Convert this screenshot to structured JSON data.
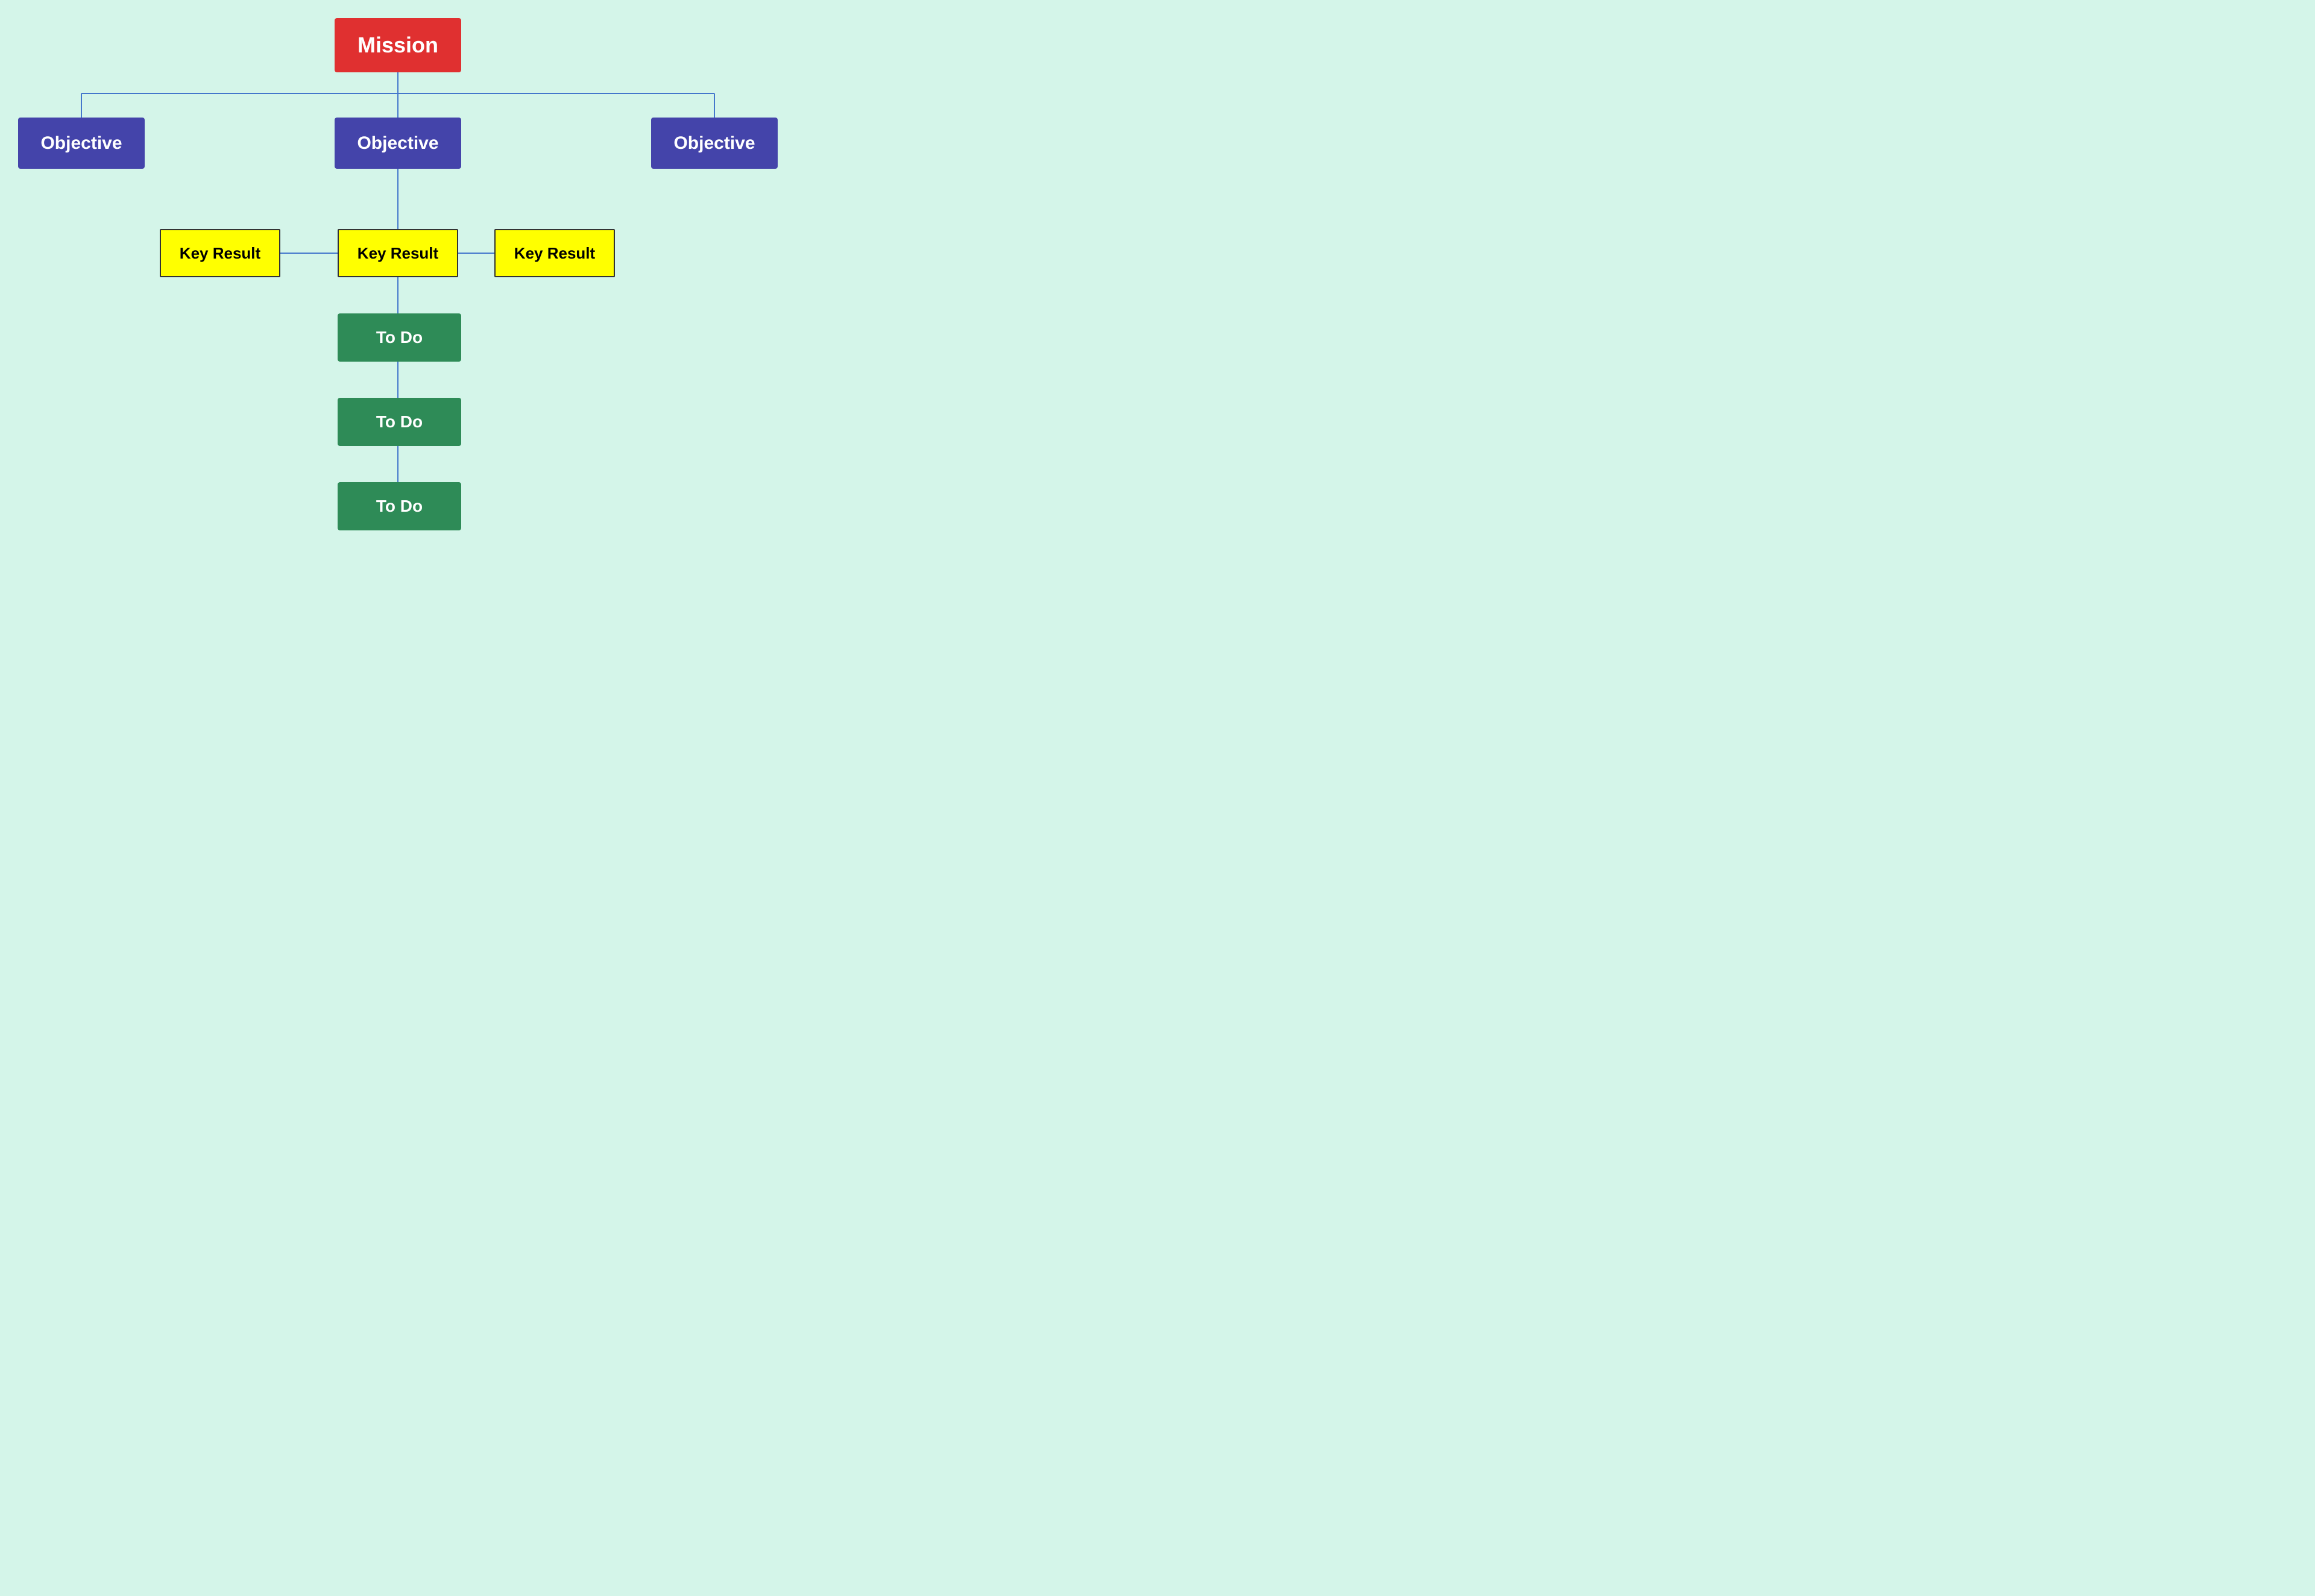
{
  "nodes": {
    "mission": {
      "label": "Mission"
    },
    "objectives": [
      {
        "id": "obj-left",
        "label": "Objective"
      },
      {
        "id": "obj-center",
        "label": "Objective"
      },
      {
        "id": "obj-right",
        "label": "Objective"
      }
    ],
    "key_results": [
      {
        "id": "kr-left",
        "label": "Key Result"
      },
      {
        "id": "kr-center",
        "label": "Key Result"
      },
      {
        "id": "kr-right",
        "label": "Key Result"
      }
    ],
    "todos": [
      {
        "id": "todo-1",
        "label": "To Do"
      },
      {
        "id": "todo-2",
        "label": "To Do"
      },
      {
        "id": "todo-3",
        "label": "To Do"
      }
    ]
  },
  "colors": {
    "mission_bg": "#e03030",
    "objective_bg": "#4444aa",
    "key_result_bg": "#ffff00",
    "todo_bg": "#2e8b57",
    "connector": "#4477cc",
    "background": "#d4f5e9"
  }
}
